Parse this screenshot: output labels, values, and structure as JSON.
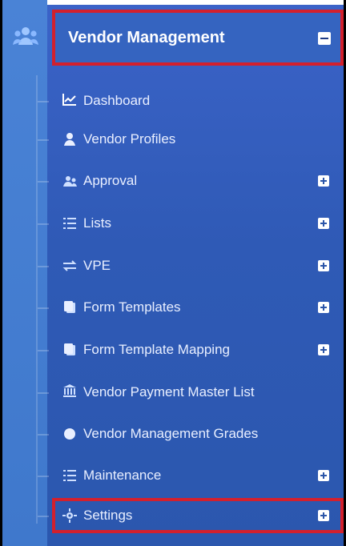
{
  "header": {
    "title": "Vendor Management",
    "rail_icon": "users-icon",
    "toggle_icon": "minus-square-icon"
  },
  "menu": [
    {
      "label": "Dashboard",
      "icon": "line-chart-icon",
      "expand": false
    },
    {
      "label": "Vendor Profiles",
      "icon": "person-icon",
      "expand": false
    },
    {
      "label": "Approval",
      "icon": "users-icon",
      "expand": true
    },
    {
      "label": "Lists",
      "icon": "list-icon",
      "expand": true
    },
    {
      "label": "VPE",
      "icon": "swap-icon",
      "expand": true
    },
    {
      "label": "Form Templates",
      "icon": "copy-icon",
      "expand": true
    },
    {
      "label": "Form Template Mapping",
      "icon": "copy-icon",
      "expand": true
    },
    {
      "label": "Vendor Payment Master List",
      "icon": "bank-icon",
      "expand": false
    },
    {
      "label": "Vendor Management Grades",
      "icon": "circle-icon",
      "expand": false
    },
    {
      "label": "Maintenance",
      "icon": "list-icon",
      "expand": true
    },
    {
      "label": "Settings",
      "icon": "gear-icon",
      "expand": true
    }
  ],
  "colors": {
    "highlight_border": "#d3202d",
    "panel": "#2f5ab6",
    "rail": "#4a83d6",
    "text": "#e9efff"
  }
}
